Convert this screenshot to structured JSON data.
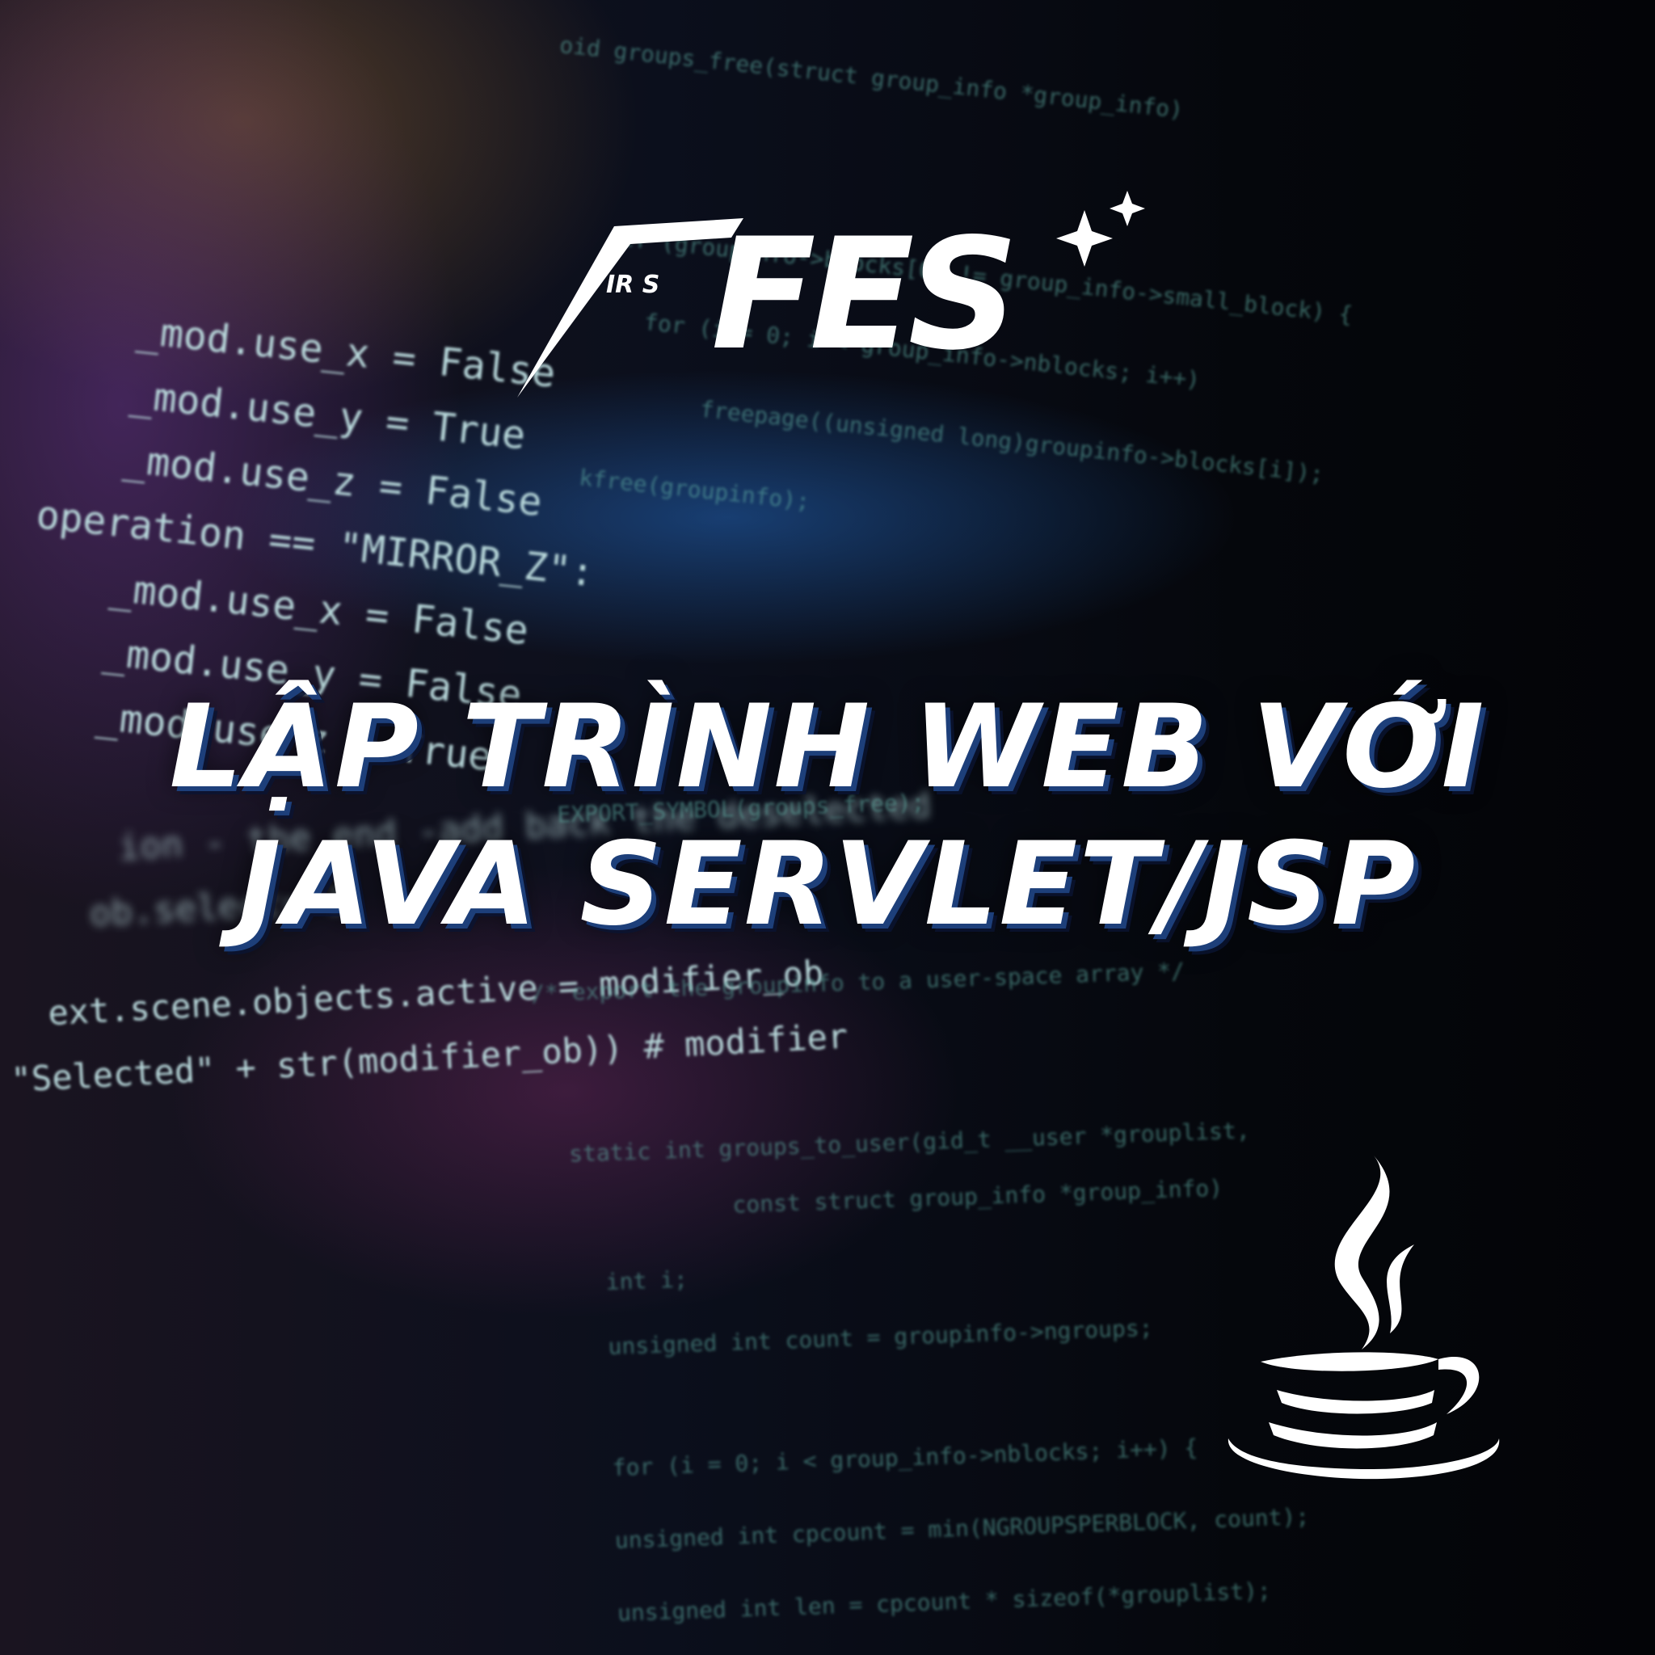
{
  "brand": {
    "logo_text": "FES",
    "logo_subtext": "IR S",
    "sparkle": "sparkle-icon"
  },
  "title": {
    "line1": "LẬP TRÌNH WEB VỚI",
    "line2": "JAVA SERVLET/JSP"
  },
  "icon": "java-coffee-cup-icon",
  "code_background": {
    "left": [
      "_mod.use_x = False",
      "_mod.use_y = True",
      "_mod.use_z = False",
      "operation == \"MIRROR_Z\":",
      "_mod.use_x = False",
      "_mod.use_y = False",
      "_mod.use_z = True",
      "ion - the end -add back the deselected",
      "ob.select= 1",
      "ext.scene.objects.active = modifier_ob",
      "\"Selected\" + str(modifier_ob)) # modifier"
    ],
    "right": [
      "oid groups_free(struct group_info *group_info)",
      "if (groupinfo->blocks[0] != group_info->small_block) {",
      "for (i = 0; i < group_info->nblocks; i++)",
      "freepage((unsigned long)groupinfo->blocks[i]);",
      "kfree(groupinfo);",
      "EXPORT_SYMBOL(groups_free);",
      "/* export the groupinfo to a user-space array */",
      "static int groups_to_user(gid_t __user *grouplist,",
      "const struct group_info *group_info)",
      "int i;",
      "unsigned int count = groupinfo->ngroups;",
      "for (i = 0; i < group_info->nblocks; i++) {",
      "unsigned int cpcount = min(NGROUPSPERBLOCK, count);",
      "unsigned int len = cpcount * sizeof(*grouplist);"
    ]
  }
}
